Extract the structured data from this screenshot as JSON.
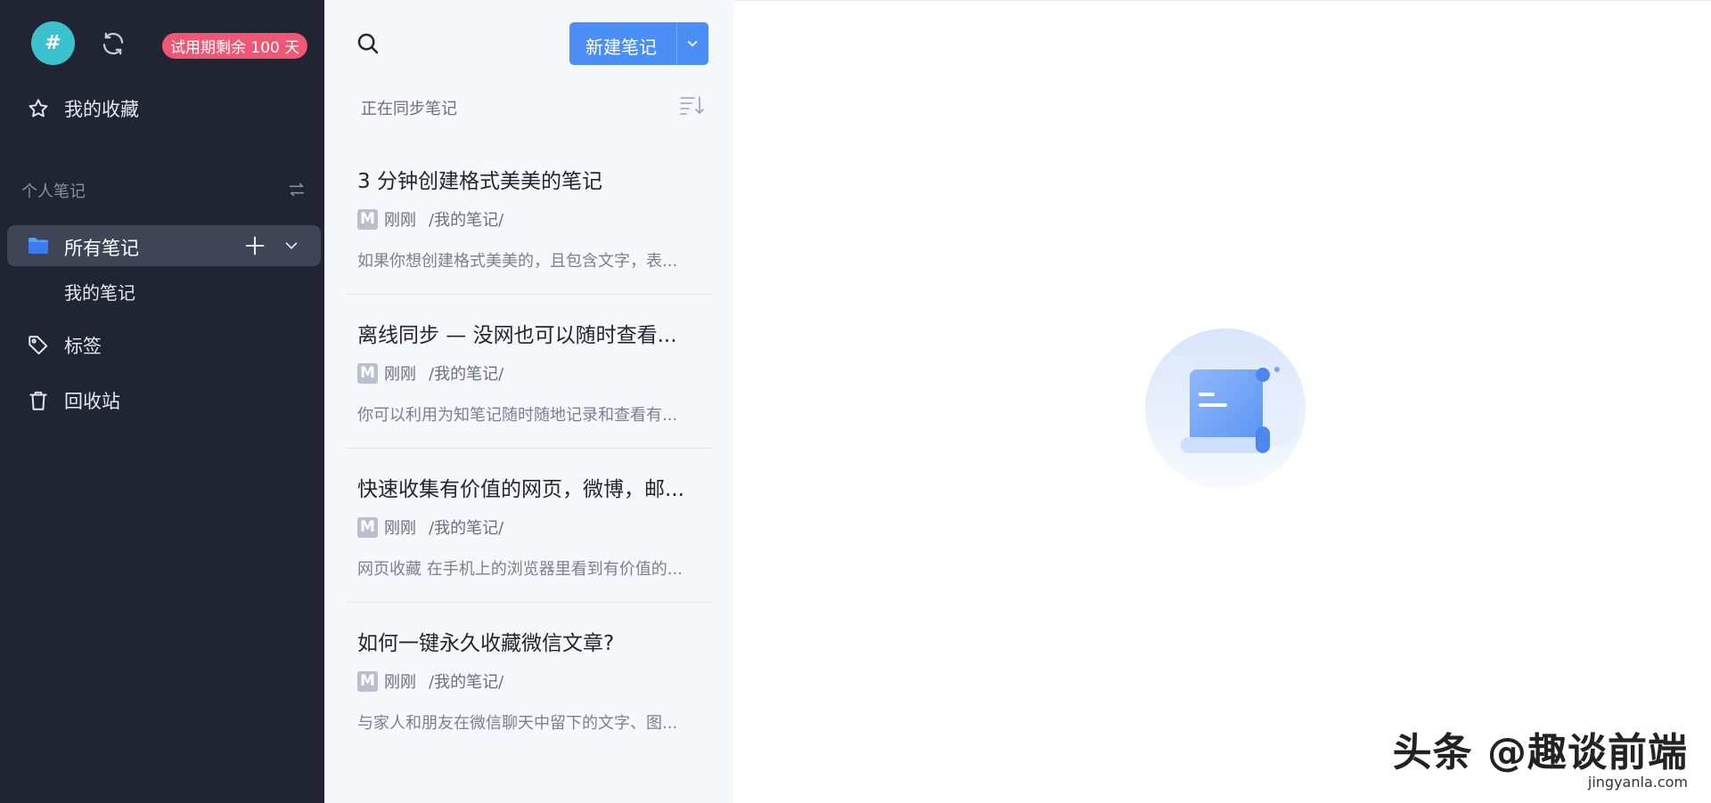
{
  "sidebar": {
    "avatar_symbol": "#",
    "trial_badge": "试用期剩余 100 天",
    "favorites_label": "我的收藏",
    "section_title": "个人笔记",
    "all_notes_label": "所有笔记",
    "sub_folder_label": "我的笔记",
    "tags_label": "标签",
    "trash_label": "回收站",
    "colors": {
      "background": "#212432",
      "active_item": "#3f4456",
      "avatar": "#3cc1cf",
      "badge": "#ef5875"
    }
  },
  "notelist": {
    "new_button_label": "新建笔记",
    "sync_status": "正在同步笔记",
    "colors": {
      "background": "#f5f7fa",
      "primary_button": "#4b8ef6"
    },
    "notes": [
      {
        "title": "3 分钟创建格式美美的笔记",
        "badge": "M",
        "time": "刚刚",
        "path": "/我的笔记/",
        "snippet": "如果你想创建格式美美的，且包含文字，表..."
      },
      {
        "title": "离线同步 — 没网也可以随时查看...",
        "badge": "M",
        "time": "刚刚",
        "path": "/我的笔记/",
        "snippet": "你可以利用为知笔记随时随地记录和查看有..."
      },
      {
        "title": "快速收集有价值的网页，微博，邮...",
        "badge": "M",
        "time": "刚刚",
        "path": "/我的笔记/",
        "snippet": "网页收藏 在手机上的浏览器里看到有价值的..."
      },
      {
        "title": "如何一键永久收藏微信文章?",
        "badge": "M",
        "time": "刚刚",
        "path": "/我的笔记/",
        "snippet": "与家人和朋友在微信聊天中留下的文字、图..."
      }
    ]
  },
  "content": {
    "watermark_line1": "头条 @趣谈前端",
    "watermark_line2": "jingyanla.com"
  },
  "icons": {
    "sync": "sync-icon",
    "star": "star-icon",
    "swap": "swap-icon",
    "folder": "folder-icon",
    "plus": "plus-icon",
    "chevron": "chevron-down-icon",
    "tag": "tag-icon",
    "trash": "trash-icon",
    "search": "search-icon",
    "sort": "sort-icon",
    "empty": "empty-note-illustration"
  }
}
